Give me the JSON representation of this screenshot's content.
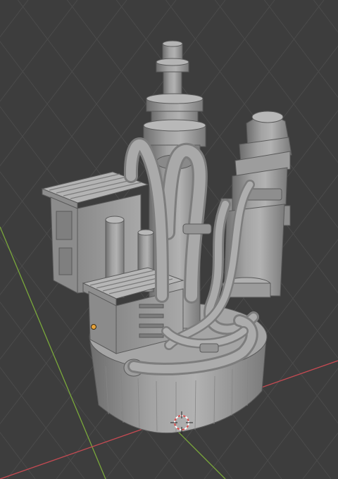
{
  "viewport": {
    "background_color": "#3d3d3d",
    "grid_line_color": "#4b4b4b",
    "x_axis_color": "#c44a52",
    "y_axis_color": "#7aa83b",
    "model_base_color": "#9a9a9a",
    "model_shade_color": "#6e6e6e",
    "model_highlight_color": "#bdbdbd",
    "origin_dot_color": "#e8a33a",
    "cursor_colors": [
      "#d94f4f",
      "#ffffff"
    ]
  }
}
